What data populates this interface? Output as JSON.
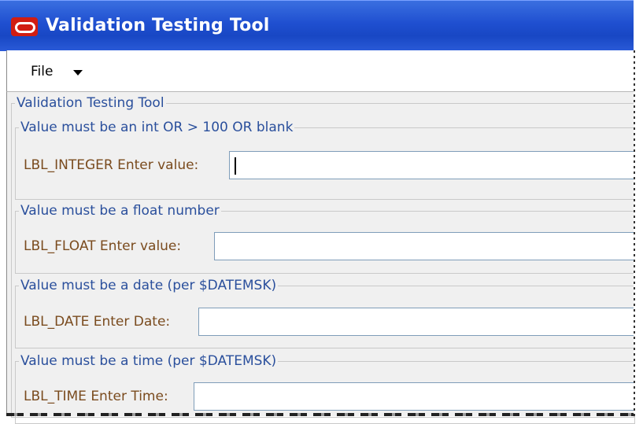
{
  "window": {
    "title": "Validation Testing Tool",
    "icon": "oracle-logo-icon",
    "title_bar_color": "#1f4fd0",
    "logo_color": "#d11d12"
  },
  "menubar": {
    "file_label": "File",
    "file_arrow": "dropdown-arrow-icon"
  },
  "main_group": {
    "title": "Validation Testing Tool"
  },
  "sections": [
    {
      "title": "Value must be an int OR > 100 OR blank",
      "label": "LBL_INTEGER Enter value:",
      "value": "",
      "focused": true
    },
    {
      "title": "Value must be a float number",
      "label": "LBL_FLOAT Enter value:",
      "value": "",
      "focused": false
    },
    {
      "title": "Value must be a date (per $DATEMSK)",
      "label": "LBL_DATE Enter Date:",
      "value": "",
      "focused": false
    },
    {
      "title": "Value must be a time (per $DATEMSK)",
      "label": "LBL_TIME Enter Time:",
      "value": "",
      "focused": false
    }
  ],
  "colors": {
    "legend_text": "#2a4f9c",
    "label_text": "#7a4b1e",
    "panel_bg": "#f0f0f0",
    "input_border": "#7f9db9"
  }
}
